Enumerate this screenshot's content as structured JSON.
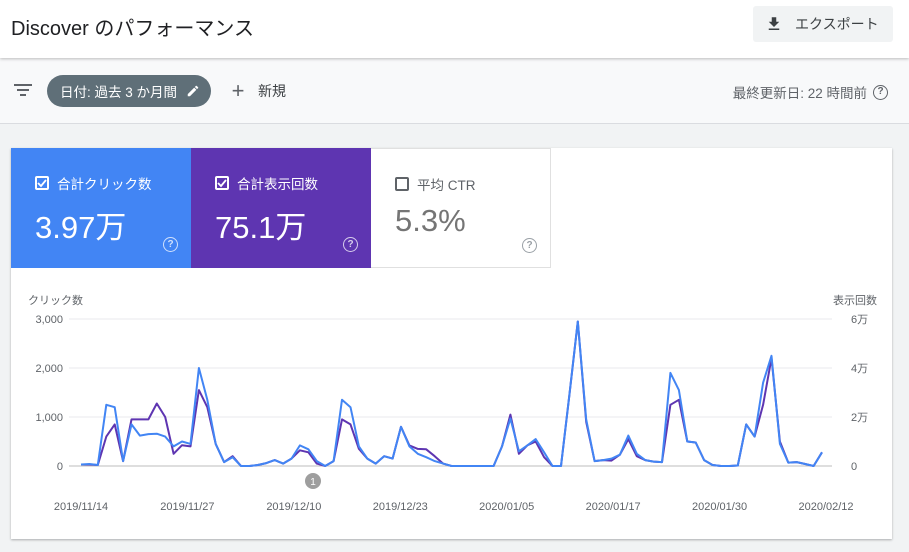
{
  "header": {
    "title": "Discover のパフォーマンス",
    "export_label": "エクスポート"
  },
  "toolbar": {
    "date_chip": "日付: 過去 3 か月間",
    "new_label": "新規",
    "last_updated": "最終更新日: 22 時間前"
  },
  "metrics": [
    {
      "label": "合計クリック数",
      "value": "3.97万",
      "checked": true,
      "color": "#4285f4"
    },
    {
      "label": "合計表示回数",
      "value": "75.1万",
      "checked": true,
      "color": "#5e35b1"
    },
    {
      "label": "平均 CTR",
      "value": "5.3%",
      "checked": false,
      "color": "#ffffff"
    }
  ],
  "chart_data": {
    "type": "line",
    "left_axis_label": "クリック数",
    "right_axis_label": "表示回数",
    "left_ticks": [
      "3,000",
      "2,000",
      "1,000",
      "0"
    ],
    "right_ticks": [
      "6万",
      "4万",
      "2万",
      "0"
    ],
    "ylim_left": [
      0,
      3000
    ],
    "ylim_right": [
      0,
      60000
    ],
    "x_tick_labels": [
      "2019/11/14",
      "2019/11/27",
      "2019/12/10",
      "2019/12/23",
      "2020/01/05",
      "2020/01/17",
      "2020/01/30",
      "2020/02/12"
    ],
    "annotation": "1",
    "series": [
      {
        "name": "クリック数",
        "axis": "left",
        "color": "#4285f4",
        "values": [
          30,
          40,
          20,
          1250,
          1200,
          100,
          850,
          620,
          650,
          660,
          600,
          400,
          500,
          450,
          2000,
          1350,
          450,
          80,
          180,
          0,
          0,
          20,
          60,
          120,
          50,
          150,
          420,
          340,
          100,
          0,
          100,
          1350,
          1200,
          400,
          150,
          50,
          200,
          150,
          800,
          400,
          250,
          180,
          100,
          50,
          0,
          0,
          0,
          0,
          0,
          0,
          400,
          970,
          300,
          420,
          550,
          280,
          0,
          0,
          1450,
          2950,
          950,
          100,
          120,
          150,
          230,
          620,
          250,
          120,
          90,
          80,
          1900,
          1550,
          500,
          480,
          120,
          20,
          0,
          0,
          10,
          850,
          600,
          1700,
          2250,
          450,
          70,
          80,
          40,
          0,
          280
        ]
      },
      {
        "name": "表示回数",
        "axis": "right",
        "color": "#5e35b1",
        "values": [
          600,
          600,
          400,
          12000,
          17000,
          2000,
          19000,
          19000,
          19000,
          25500,
          20000,
          5000,
          8500,
          8000,
          31000,
          24000,
          9000,
          1600,
          4000,
          0,
          0,
          400,
          1200,
          2400,
          1000,
          3000,
          6400,
          5600,
          1000,
          0,
          2000,
          19000,
          17000,
          7000,
          3000,
          1000,
          4000,
          3000,
          16000,
          8400,
          7000,
          6800,
          4000,
          1000,
          0,
          0,
          0,
          0,
          0,
          0,
          8000,
          21000,
          5000,
          8400,
          10000,
          3600,
          0,
          0,
          29000,
          59000,
          18000,
          2000,
          2400,
          2200,
          4600,
          11000,
          4000,
          2400,
          1800,
          1600,
          25000,
          27000,
          10000,
          9600,
          2400,
          400,
          0,
          0,
          200,
          17000,
          12000,
          25000,
          44000,
          10000,
          1400,
          1600,
          800,
          0,
          5600
        ]
      }
    ]
  }
}
